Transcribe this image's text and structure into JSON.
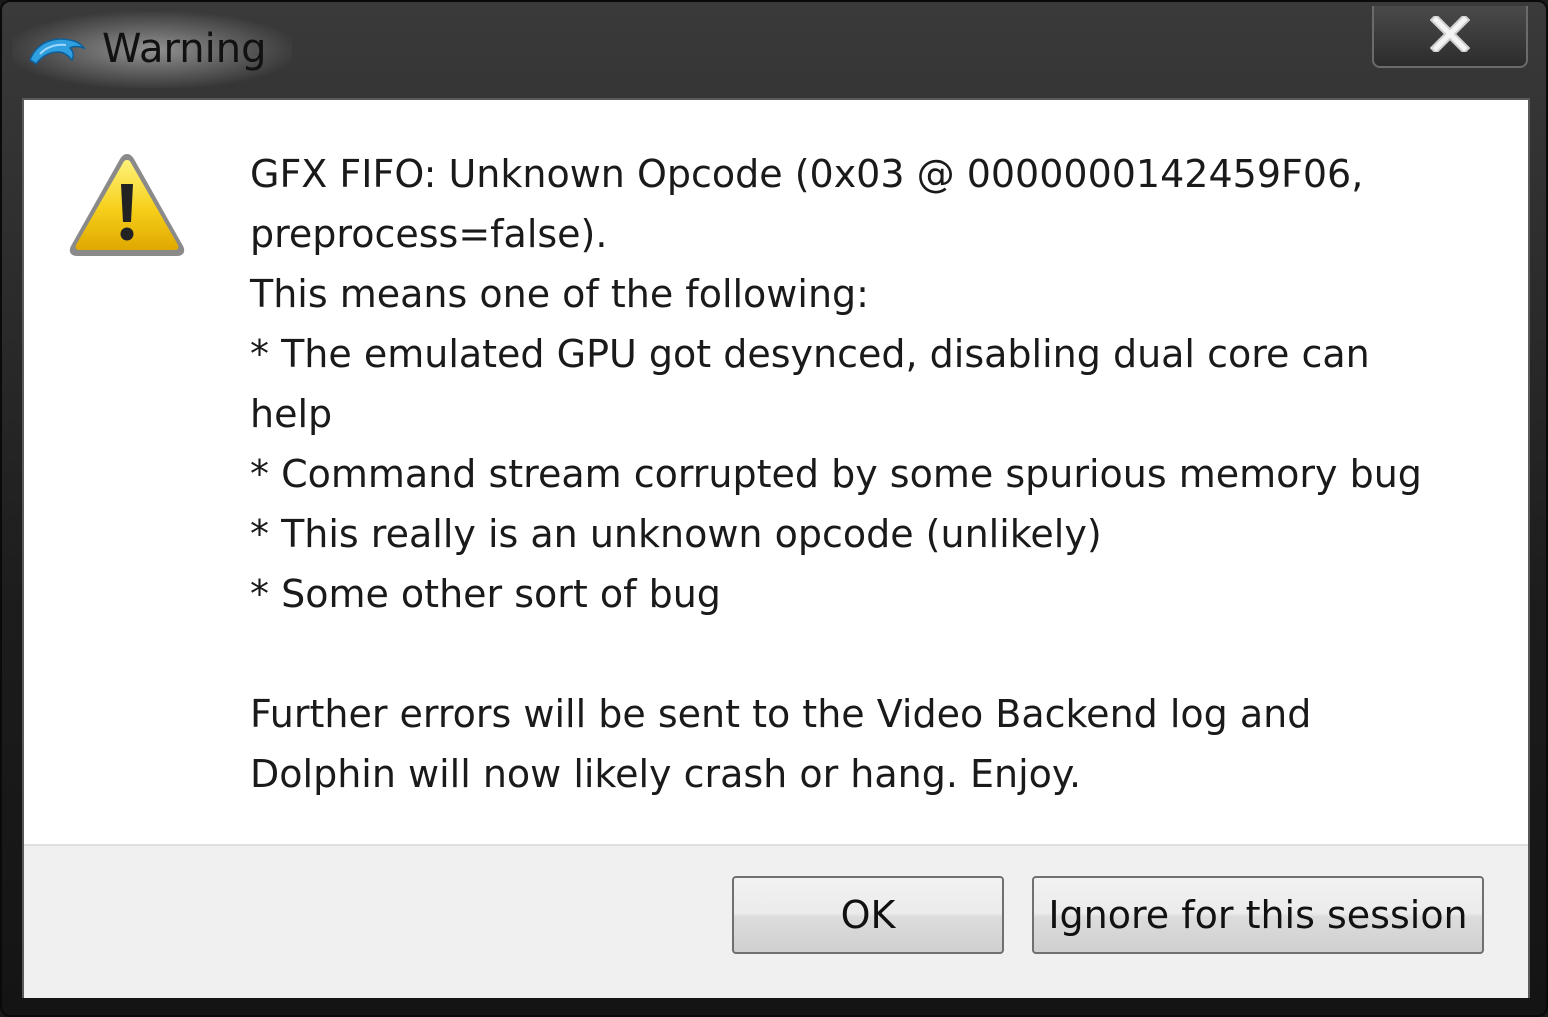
{
  "window": {
    "title": "Warning",
    "app_icon": "dolphin-icon",
    "close_icon": "close-icon"
  },
  "dialog": {
    "icon": "warning-icon",
    "message_lines": [
      "GFX FIFO: Unknown Opcode (0x03 @ 0000000142459F06,",
      "preprocess=false).",
      "This means one of the following:",
      "* The emulated GPU got desynced, disabling dual core can",
      "help",
      "* Command stream corrupted by some spurious memory bug",
      "* This really is an unknown opcode (unlikely)",
      "* Some other sort of bug",
      "",
      "Further errors will be sent to the Video Backend log and",
      "Dolphin will now likely crash or hang. Enjoy."
    ]
  },
  "buttons": {
    "ok_label": "OK",
    "ignore_label": "Ignore for this session"
  },
  "colors": {
    "titlebar": "#1c1c1c",
    "client_background": "#ffffff",
    "footer_background": "#f0f0f0",
    "warning_yellow": "#f2c400"
  }
}
